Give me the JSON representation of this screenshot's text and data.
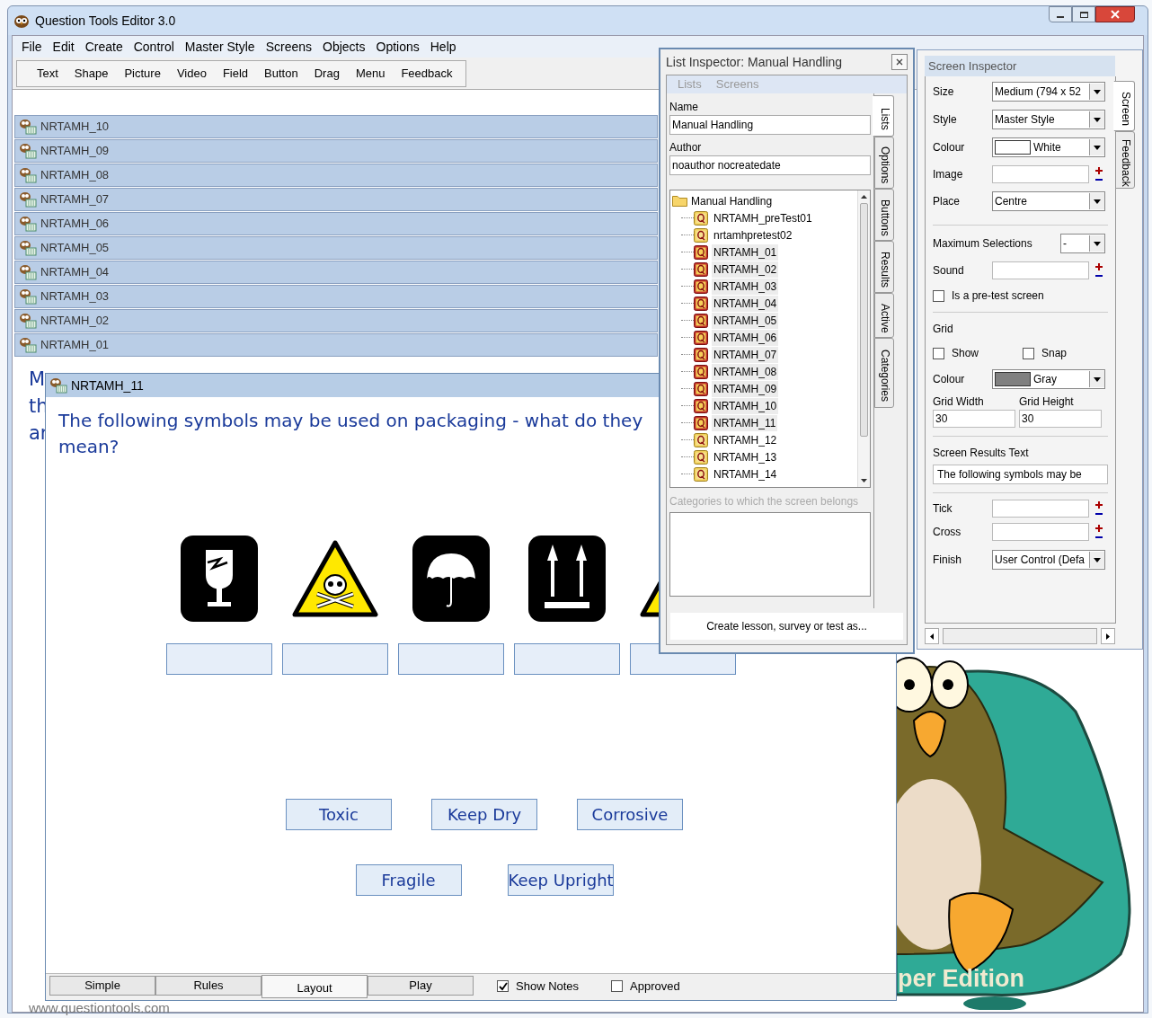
{
  "window": {
    "title": "Question Tools Editor 3.0"
  },
  "menu": [
    "File",
    "Edit",
    "Create",
    "Control",
    "Master Style",
    "Screens",
    "Objects",
    "Options",
    "Help"
  ],
  "toolbar": [
    "Text",
    "Shape",
    "Picture",
    "Video",
    "Field",
    "Button",
    "Drag",
    "Menu",
    "Feedback"
  ],
  "screens": [
    "NRTAMH_10",
    "NRTAMH_09",
    "NRTAMH_08",
    "NRTAMH_07",
    "NRTAMH_06",
    "NRTAMH_05",
    "NRTAMH_04",
    "NRTAMH_03",
    "NRTAMH_02",
    "NRTAMH_01"
  ],
  "background_text": [
    "M",
    "th",
    "ar"
  ],
  "site_url": "www.questiontools.com",
  "edition_text": "per Edition",
  "question_window": {
    "title": "NRTAMH_11",
    "question": "The following symbols may be used on packaging - what do they mean?",
    "symbols": [
      {
        "kind": "fragile"
      },
      {
        "kind": "toxic"
      },
      {
        "kind": "dry"
      },
      {
        "kind": "upright"
      },
      {
        "kind": "corrosive"
      }
    ],
    "answer_rows": [
      {
        "labels": [
          "Toxic",
          "Keep Dry",
          "Corrosive"
        ]
      },
      {
        "labels": [
          "Fragile",
          "Keep Upright"
        ]
      }
    ],
    "tabs": [
      {
        "label": "Simple",
        "selected": false
      },
      {
        "label": "Rules",
        "selected": false
      },
      {
        "label": "Layout",
        "selected": true
      },
      {
        "label": "Play",
        "selected": false
      }
    ],
    "options": [
      {
        "label": "Show Notes",
        "checked": true
      },
      {
        "label": "Approved",
        "checked": false
      }
    ]
  },
  "list_inspector": {
    "title": "List Inspector: Manual Handling",
    "menu": [
      "Lists",
      "Screens"
    ],
    "name_label": "Name",
    "name": "Manual Handling",
    "author_label": "Author",
    "author": "noauthor nocreatedate",
    "tree": {
      "label": "Manual Handling",
      "children": [
        {
          "label": "NRTAMH_preTest01",
          "highlighted": false
        },
        {
          "label": "nrtamhpretest02",
          "highlighted": false
        },
        {
          "label": "NRTAMH_01",
          "highlighted": true
        },
        {
          "label": "NRTAMH_02",
          "highlighted": true
        },
        {
          "label": "NRTAMH_03",
          "highlighted": true
        },
        {
          "label": "NRTAMH_04",
          "highlighted": true
        },
        {
          "label": "NRTAMH_05",
          "highlighted": true
        },
        {
          "label": "NRTAMH_06",
          "highlighted": true
        },
        {
          "label": "NRTAMH_07",
          "highlighted": true
        },
        {
          "label": "NRTAMH_08",
          "highlighted": true
        },
        {
          "label": "NRTAMH_09",
          "highlighted": true
        },
        {
          "label": "NRTAMH_10",
          "highlighted": true
        },
        {
          "label": "NRTAMH_11",
          "highlighted": true
        },
        {
          "label": "NRTAMH_12",
          "highlighted": false
        },
        {
          "label": "NRTAMH_13",
          "highlighted": false
        },
        {
          "label": "NRTAMH_14",
          "highlighted": false
        }
      ]
    },
    "categories_label": "Categories to which the screen belongs",
    "create_button": "Create lesson, survey or test as...",
    "tabs": [
      {
        "label": "Lists",
        "selected": true
      },
      {
        "label": "Options",
        "selected": false
      },
      {
        "label": "Buttons",
        "selected": false
      },
      {
        "label": "Results",
        "selected": false
      },
      {
        "label": "Active",
        "selected": false
      },
      {
        "label": "Categories",
        "selected": false
      }
    ]
  },
  "screen_inspector": {
    "title": "Screen Inspector",
    "size": {
      "label": "Size",
      "value": "Medium (794 x 52"
    },
    "style": {
      "label": "Style",
      "value": "Master Style"
    },
    "colour": {
      "label": "Colour",
      "value": "White",
      "color": "#ffffff"
    },
    "image": {
      "label": "Image"
    },
    "place": {
      "label": "Place",
      "value": "Centre"
    },
    "max_selections": {
      "label": "Maximum Selections",
      "value": "-"
    },
    "sound": {
      "label": "Sound"
    },
    "pretest": {
      "label": "Is a pre-test screen",
      "checked": false
    },
    "grid_label": "Grid",
    "grid_show": {
      "label": "Show",
      "checked": false
    },
    "grid_snap": {
      "label": "Snap",
      "checked": false
    },
    "grid_colour": {
      "label": "Colour",
      "value": "Gray",
      "color": "#808080"
    },
    "grid_width": {
      "label": "Grid Width",
      "value": "30"
    },
    "grid_height": {
      "label": "Grid Height",
      "value": "30"
    },
    "results_label": "Screen Results Text",
    "results_text": "The following symbols may be",
    "tick": {
      "label": "Tick"
    },
    "cross": {
      "label": "Cross"
    },
    "finish": {
      "label": "Finish",
      "value": "User Control (Defa"
    },
    "tabs": [
      {
        "label": "Screen",
        "selected": true
      },
      {
        "label": "Feedback",
        "selected": false
      }
    ]
  }
}
